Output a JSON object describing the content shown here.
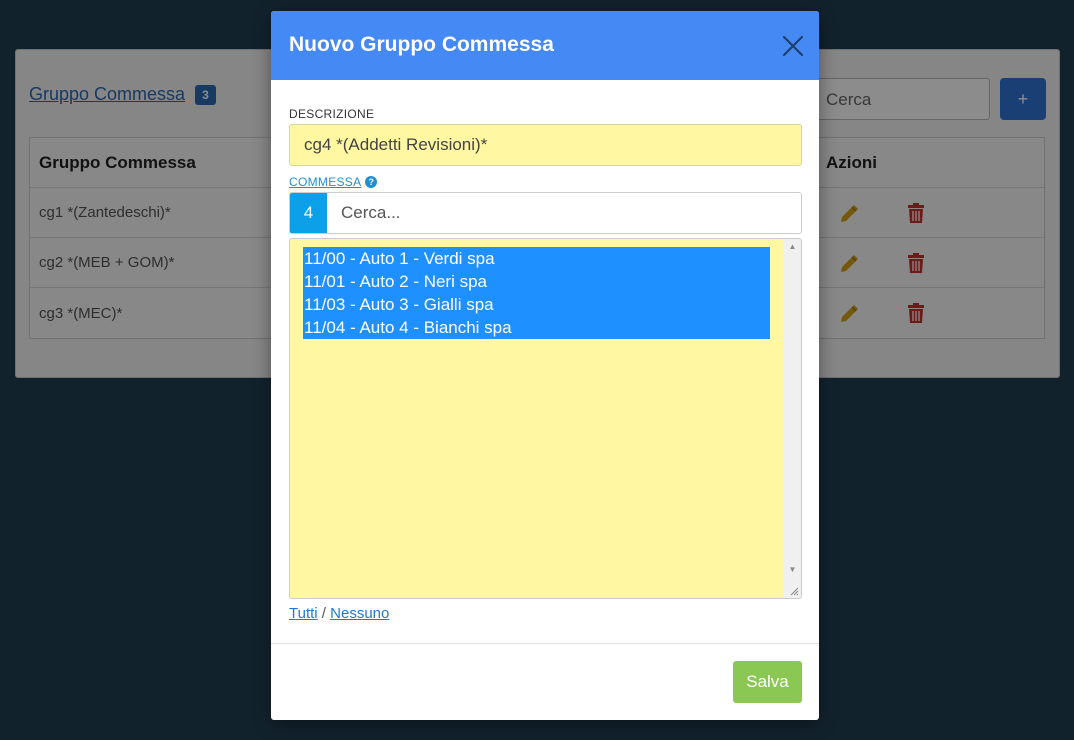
{
  "background": {
    "title": "Gruppo Commessa",
    "count": "3",
    "search_placeholder": "Cerca",
    "add_label": "+",
    "table": {
      "headers": [
        "Gruppo Commessa",
        "Azioni"
      ],
      "rows": [
        {
          "name": "cg1 *(Zantedeschi)*"
        },
        {
          "name": "cg2 *(MEB + GOM)*"
        },
        {
          "name": "cg3 *(MEC)*"
        }
      ]
    }
  },
  "modal": {
    "title": "Nuovo Gruppo Commessa",
    "descrizione_label": "DESCRIZIONE",
    "descrizione_value": "cg4 *(Addetti Revisioni)*",
    "commessa_label": "COMMESSA",
    "help": "?",
    "selected_count": "4",
    "search_placeholder": "Cerca...",
    "options": [
      "11/00 - Auto 1 - Verdi spa",
      "11/01 - Auto 2 - Neri spa",
      "11/03 - Auto 3 - Gialli spa",
      "11/04 - Auto 4 - Bianchi spa"
    ],
    "link_all": "Tutti",
    "link_sep": "/",
    "link_none": "Nessuno",
    "save_label": "Salva"
  },
  "colors": {
    "header_blue": "#4589f5",
    "field_yellow": "#fff7a1",
    "selected_blue": "#1e90ff",
    "save_green": "#8ac753"
  }
}
